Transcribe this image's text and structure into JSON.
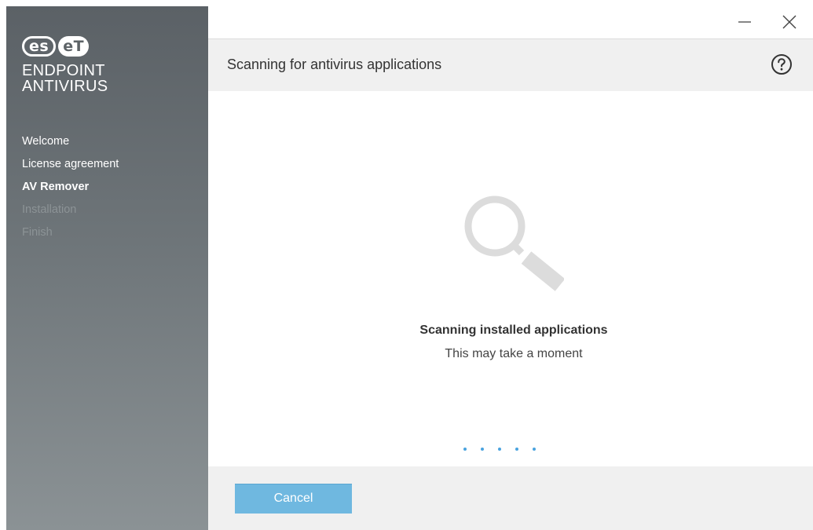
{
  "sidebar": {
    "logo_left": "es",
    "logo_right": "eT",
    "product_line1": "ENDPOINT",
    "product_line2": "ANTIVIRUS",
    "steps": [
      {
        "label": "Welcome",
        "state": "done"
      },
      {
        "label": "License agreement",
        "state": "done"
      },
      {
        "label": "AV Remover",
        "state": "current"
      },
      {
        "label": "Installation",
        "state": "future"
      },
      {
        "label": "Finish",
        "state": "future"
      }
    ]
  },
  "window": {
    "minimize_icon": "minimize-icon",
    "close_icon": "close-icon"
  },
  "header": {
    "title": "Scanning for antivirus applications",
    "help_icon": "help-icon"
  },
  "main": {
    "icon": "magnifier-icon",
    "status_title": "Scanning installed applications",
    "status_subtitle": "This may take a moment",
    "progress_dots": 5
  },
  "footer": {
    "cancel_label": "Cancel"
  },
  "colors": {
    "accent": "#6fb8e0",
    "dot": "#4aa3df",
    "sidebar_top": "#5b6166",
    "sidebar_bottom": "#8b9295",
    "header_bg": "#f0f0f0"
  }
}
